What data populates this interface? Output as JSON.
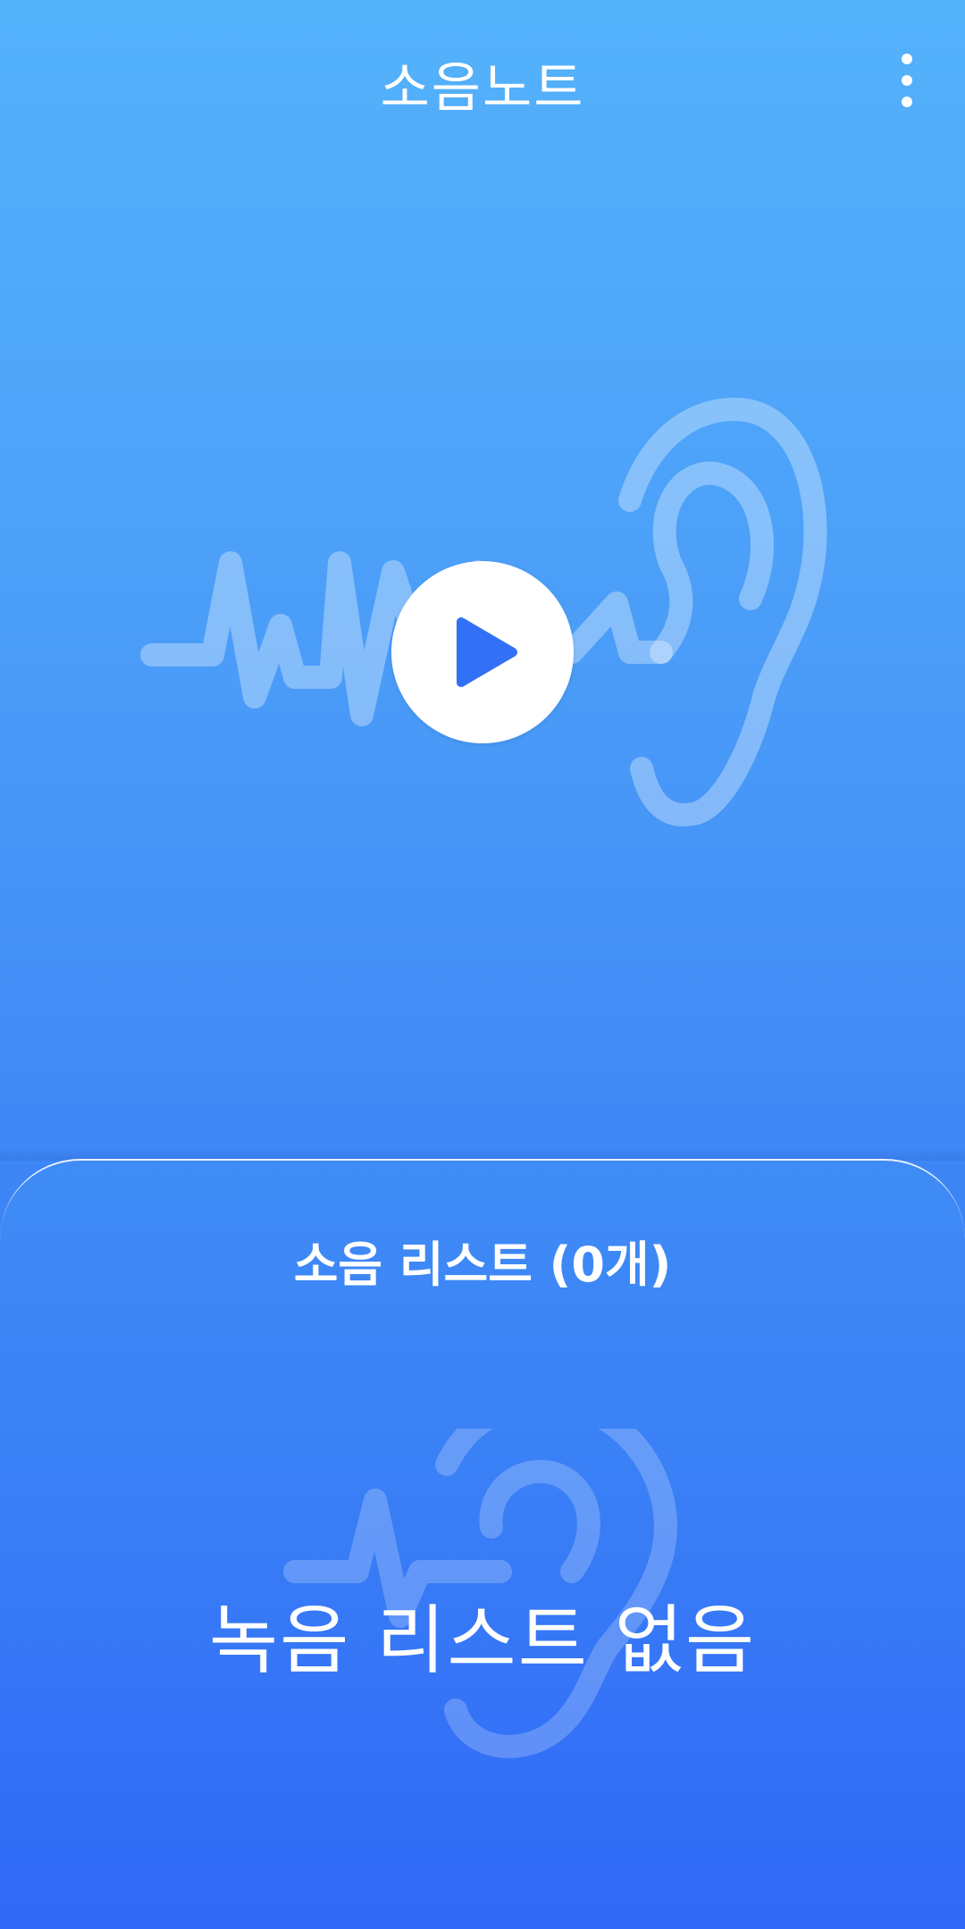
{
  "app_bar": {
    "title": "소음노트",
    "more_icon": "more-vertical-icon"
  },
  "hero": {
    "illustration_icon": "ear-soundwave-icon",
    "play_icon": "play-icon",
    "play_color": "#3270f6"
  },
  "sheet": {
    "title": "소음 리스트 (0개)",
    "empty_message": "녹음 리스트 없음",
    "watermark_icon": "ear-soundwave-icon"
  },
  "colors": {
    "background_top": "#54b2fb",
    "background_bottom": "#2f68f6",
    "text": "#ffffff"
  }
}
